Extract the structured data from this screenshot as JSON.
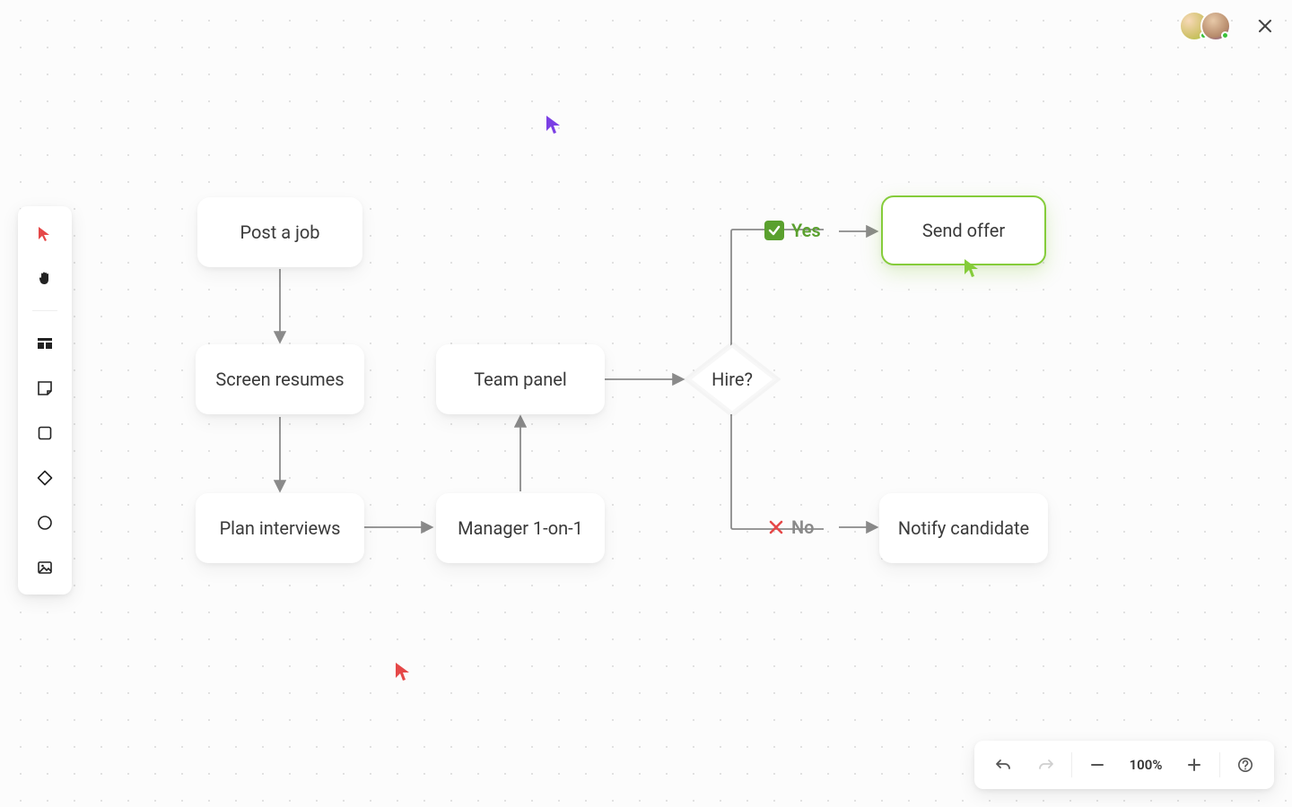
{
  "canvas": {
    "nodes": {
      "post_job": "Post a job",
      "screen_resumes": "Screen resumes",
      "plan_interviews": "Plan interviews",
      "manager_1on1": "Manager 1-on-1",
      "team_panel": "Team panel",
      "hire_decision": "Hire?",
      "send_offer": "Send offer",
      "notify_candidate": "Notify candidate"
    },
    "branches": {
      "yes": "Yes",
      "no": "No"
    }
  },
  "toolbar": {
    "tools": [
      {
        "name": "select",
        "icon": "cursor"
      },
      {
        "name": "hand",
        "icon": "hand"
      },
      {
        "name": "section",
        "icon": "section"
      },
      {
        "name": "sticky",
        "icon": "sticky"
      },
      {
        "name": "rectangle",
        "icon": "rect"
      },
      {
        "name": "diamond",
        "icon": "diamond"
      },
      {
        "name": "ellipse",
        "icon": "ellipse"
      },
      {
        "name": "image",
        "icon": "image"
      }
    ]
  },
  "topbar": {
    "collaborators": [
      {
        "color": "#a2c43c",
        "online": true
      },
      {
        "color": "#6a3ea1",
        "online": true
      }
    ]
  },
  "cursors": [
    {
      "owner": "user-purple",
      "color": "#7b3fe4"
    },
    {
      "owner": "user-red",
      "color": "#e54848"
    },
    {
      "owner": "user-green",
      "color": "#85cc3a"
    }
  ],
  "zoom": {
    "level": "100%"
  },
  "selected_node": "send_offer",
  "colors": {
    "arrow": "#8a8a8a",
    "accent_green": "#85cc3a",
    "accent_purple": "#7b3fe4",
    "accent_red": "#e54848"
  }
}
